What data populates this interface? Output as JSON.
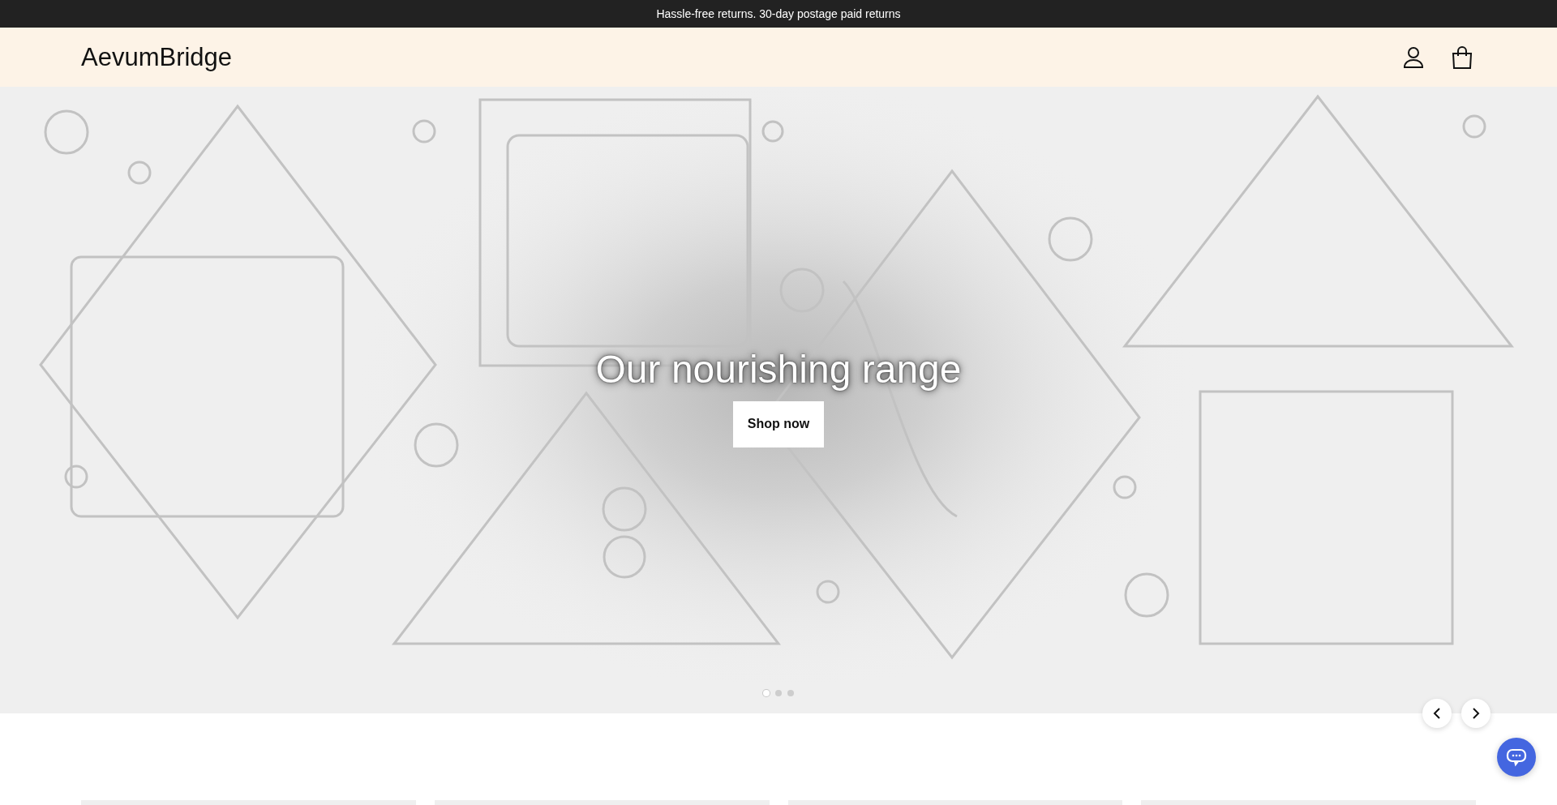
{
  "announcement": {
    "text": "Hassle-free returns. 30-day postage paid returns"
  },
  "header": {
    "logo": "AevumBridge"
  },
  "hero": {
    "title": "Our nourishing range",
    "button": "Shop now",
    "slides": [
      {
        "selected": true
      },
      {
        "selected": false
      },
      {
        "selected": false
      }
    ]
  }
}
